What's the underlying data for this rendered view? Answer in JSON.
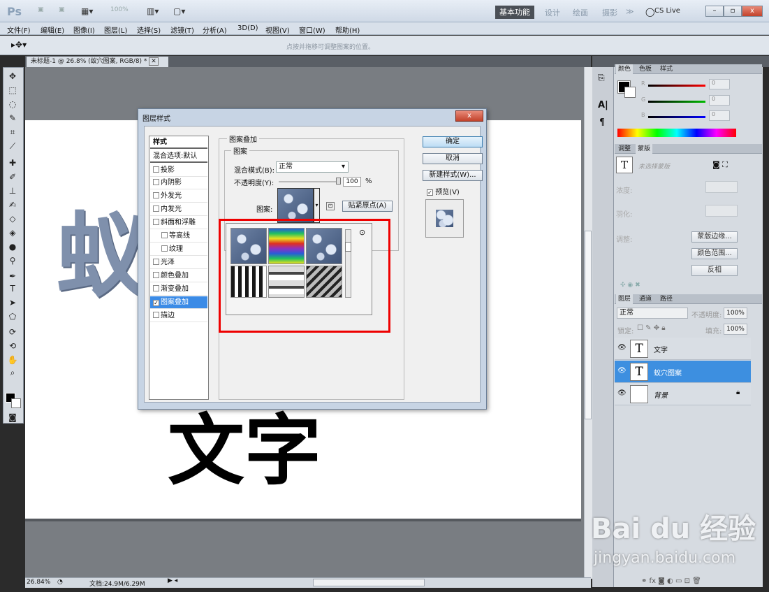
{
  "app": {
    "logo": "Ps",
    "zoom_display": "100%",
    "workspaces": [
      "基本功能",
      "设计",
      "绘画",
      "摄影",
      "≫"
    ],
    "cs_live": "CS Live"
  },
  "menu": [
    "文件(F)",
    "编辑(E)",
    "图像(I)",
    "图层(L)",
    "选择(S)",
    "滤镜(T)",
    "分析(A)",
    "3D(D)",
    "视图(V)",
    "窗口(W)",
    "帮助(H)"
  ],
  "options_hint": "点按并拖移可调整图案的位置。",
  "document": {
    "tab": "未标题-1 @ 26.8% (蚁穴图案, RGB/8) *",
    "zoom": "26.84%",
    "doc_info": "文档:24.9M/6.29M",
    "text_top": "蚁穴图案",
    "text_bottom": "文字"
  },
  "color_panel": {
    "tabs": [
      "颜色",
      "色板",
      "样式"
    ],
    "channels": [
      {
        "label": "R",
        "value": "0"
      },
      {
        "label": "G",
        "value": "0"
      },
      {
        "label": "B",
        "value": "0"
      }
    ]
  },
  "adjust_panel": {
    "tabs": [
      "调整",
      "蒙版"
    ],
    "no_mask": "未选择蒙版",
    "density_label": "浓度:",
    "feather_label": "羽化:",
    "refine_label": "调整:",
    "buttons": [
      "蒙版边缘...",
      "颜色范围...",
      "反相"
    ]
  },
  "layers_panel": {
    "tabs": [
      "图层",
      "通道",
      "路径"
    ],
    "blend_mode": "正常",
    "opacity_label": "不透明度:",
    "opacity": "100%",
    "lock_label": "锁定:",
    "fill_label": "填充:",
    "fill": "100%",
    "layers": [
      {
        "name": "文字",
        "thumb": "T"
      },
      {
        "name": "蚁穴图案",
        "thumb": "T"
      },
      {
        "name": "背景",
        "thumb": ""
      }
    ]
  },
  "watermark": {
    "line1": "Bai du 经验",
    "line2": "jingyan.baidu.com"
  },
  "dialog": {
    "title": "图层样式",
    "close": "x",
    "styles_header": "样式",
    "blend_default": "混合选项:默认",
    "style_items": [
      "投影",
      "内阴影",
      "外发光",
      "内发光",
      "斜面和浮雕",
      "等高线",
      "纹理",
      "光泽",
      "颜色叠加",
      "渐变叠加",
      "图案叠加",
      "描边"
    ],
    "section_title": "图案叠加",
    "group_title": "图案",
    "blend_mode_label": "混合模式(B):",
    "blend_mode_value": "正常",
    "opacity_label": "不透明度(Y):",
    "opacity_value": "100",
    "opacity_unit": "%",
    "pattern_label": "图案:",
    "snap_button": "贴紧原点(A)",
    "ok": "确定",
    "cancel": "取消",
    "new_style": "新建样式(W)...",
    "preview_label": "预览(V)"
  }
}
